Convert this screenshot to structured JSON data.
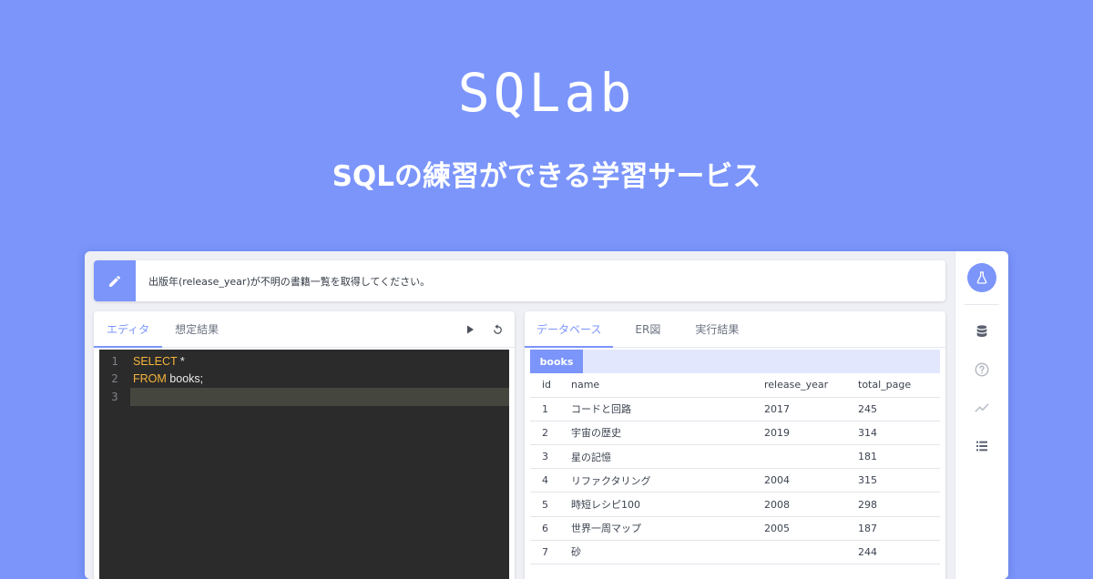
{
  "hero": {
    "title": "SQLab",
    "subtitle": "SQLの練習ができる学習サービス"
  },
  "task": {
    "icon": "pencil-icon",
    "text": "出版年(release_year)が不明の書籍一覧を取得してください。"
  },
  "editor_panel": {
    "tabs": [
      "エディタ",
      "想定結果"
    ],
    "active_tab": 0,
    "tools": [
      "play-icon",
      "reset-icon"
    ],
    "lines": [
      {
        "no": "1",
        "keyword": "SELECT",
        "rest": " *"
      },
      {
        "no": "2",
        "keyword": "FROM",
        "rest": " books;"
      },
      {
        "no": "3",
        "keyword": "",
        "rest": ""
      }
    ]
  },
  "db_panel": {
    "tabs": [
      "データベース",
      "ER図",
      "実行結果"
    ],
    "active_tab": 0,
    "table_name": "books",
    "columns": [
      "id",
      "name",
      "release_year",
      "total_page"
    ],
    "rows": [
      [
        "1",
        "コードと回路",
        "2017",
        "245"
      ],
      [
        "2",
        "宇宙の歴史",
        "2019",
        "314"
      ],
      [
        "3",
        "星の記憶",
        "",
        "181"
      ],
      [
        "4",
        "リファクタリング",
        "2004",
        "315"
      ],
      [
        "5",
        "時短レシピ100",
        "2008",
        "298"
      ],
      [
        "6",
        "世界一周マップ",
        "2005",
        "187"
      ],
      [
        "7",
        "砂",
        "",
        "244"
      ]
    ]
  },
  "sidebar": {
    "main_icon": "flask-icon",
    "icons": [
      "database-icon",
      "help-icon",
      "trend-icon",
      "list-icon"
    ]
  },
  "colors": {
    "background": "#7b95fb",
    "accent": "#7b95fb",
    "editor_bg": "#2b2b2b",
    "keyword": "#f5b53b"
  }
}
